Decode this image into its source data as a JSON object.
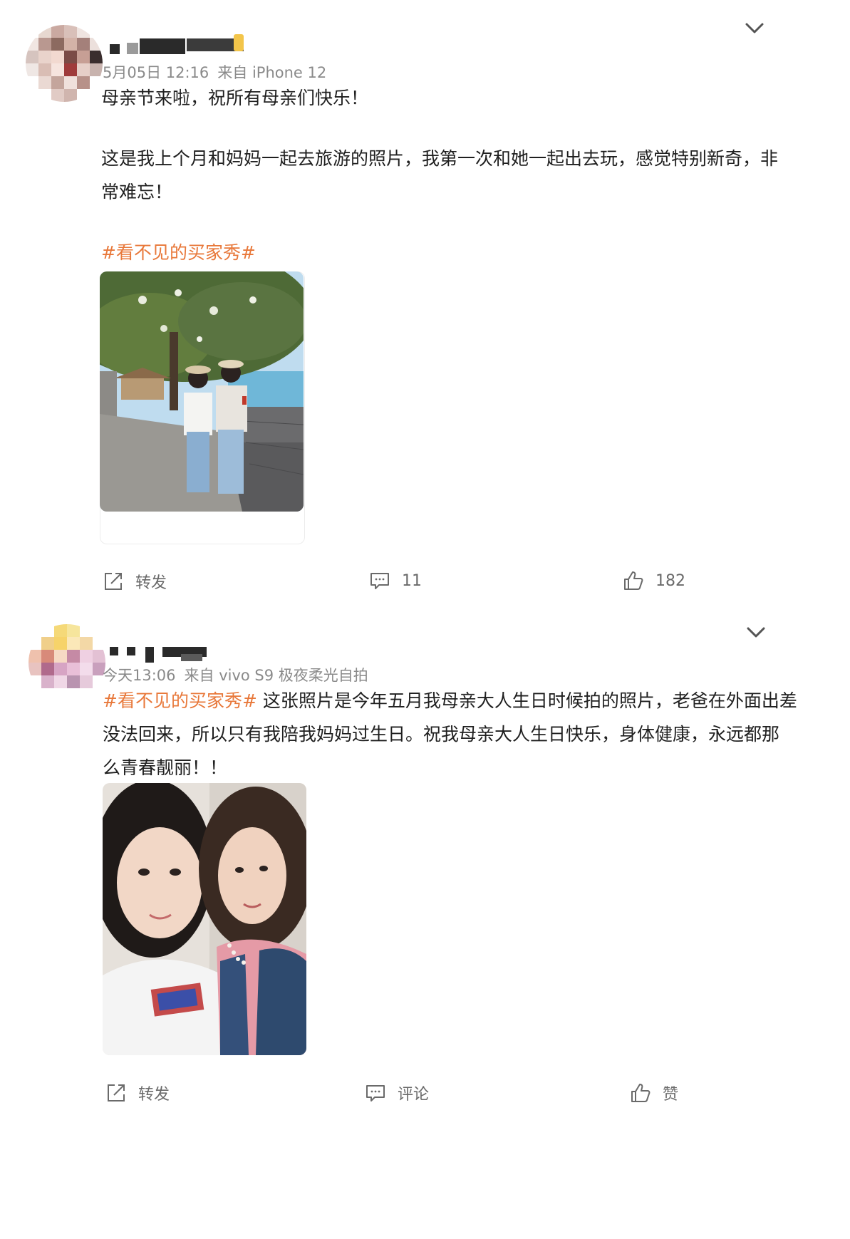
{
  "posts": [
    {
      "time": "5月05日 12:16",
      "source": "来自 iPhone 12",
      "text_lines": [
        "母亲节来啦，祝所有母亲们快乐！",
        "",
        "这是我上个月和妈妈一起去旅游的照片，我第一次和她一起出去玩，感觉特别新奇，非",
        "常难忘！"
      ],
      "hashtag": "#看不见的买家秀#",
      "photo_icon": "photo-two-women-lakeside",
      "actions": {
        "repost": "转发",
        "comment": "11",
        "like": "182"
      }
    },
    {
      "time": "今天13:06",
      "source": "来自 vivo S9 极夜柔光自拍",
      "hashtag": "#看不见的买家秀#",
      "text_first": "这张照片是今年五月我母亲大人生日时候拍的照片，老爸在外面出差",
      "text_lines": [
        "没法回来，所以只有我陪我妈妈过生日。祝我母亲大人生日快乐，身体健康，永远都那",
        "么青春靓丽！！"
      ],
      "photo_icon": "photo-mother-daughter-selfie",
      "actions": {
        "repost": "转发",
        "comment": "评论",
        "like": "赞"
      }
    }
  ],
  "colors": {
    "hashtag": "#e8783a",
    "meta": "#8a8a8a",
    "icon": "#6a6a6a"
  }
}
